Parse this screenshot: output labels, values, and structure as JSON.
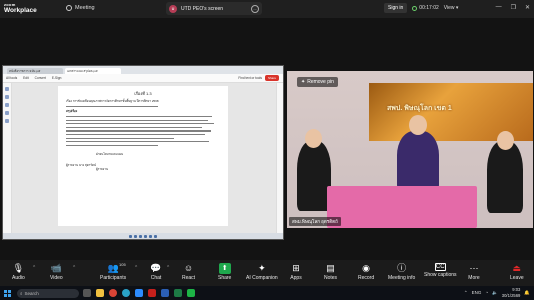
{
  "titlebar": {
    "logo_top": "zoom",
    "logo_bottom": "Workplace",
    "meeting_label": "Meeting",
    "share_initials": "U",
    "share_title": "UTD PEO's screen",
    "share_more": "...",
    "sign_in": "Sign in",
    "timer": "00:17:02",
    "view": "View",
    "window_controls": [
      "—",
      "❐",
      "✕"
    ]
  },
  "pdf": {
    "tabs": [
      "หนังสือราชการ ฉบับ.pdf",
      "เอกสารแนบ สรุปผล.pdf"
    ],
    "menu": [
      "All tools",
      "Edit",
      "Convert",
      "E-Sign"
    ],
    "find_text": "Find text or tools",
    "share_button": "Share",
    "page_heading": "เรื่องที่ 1.3",
    "page_subject": "เรื่อง การขับเคลื่อนคุณภาพการจัดการศึกษาขั้นพื้นฐาน ปีการศึกษา 2568",
    "page_section": "สรุปเรื่อง",
    "page_signature": "ฝ่ายนโยบายและแผน",
    "page_footer_name": "ผู้รายงาน นาง สุดารัตน์",
    "page_footer_role": "ผู้รายงาน"
  },
  "video": {
    "pin_label": "Remove pin",
    "banner_text": "สพป. พิษณุโลก เขต 1",
    "participant_name": "สพม.พิษณุโลก อุตรดิตถ์"
  },
  "toolbar": {
    "audio": "Audio",
    "video": "Video",
    "participants": "Participants",
    "participants_count": "105",
    "chat": "Chat",
    "react": "React",
    "share": "Share",
    "ai_companion": "AI Companion",
    "apps": "Apps",
    "notes": "Notes",
    "record": "Record",
    "meeting_info": "Meeting info",
    "show_captions": "Show captions",
    "more": "More",
    "leave": "Leave"
  },
  "taskbar": {
    "search": "Search",
    "lang": "ENG",
    "time": "9:03",
    "date": "30/1/2569"
  }
}
